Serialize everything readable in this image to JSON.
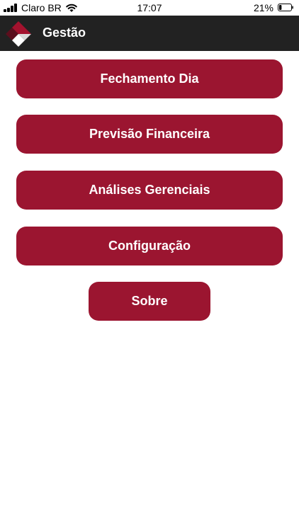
{
  "status_bar": {
    "carrier": "Claro BR",
    "time": "17:07",
    "battery": "21%",
    "signal_icon": "signal-bars-icon",
    "wifi_icon": "wifi-icon",
    "battery_icon": "battery-icon",
    "battery_level": 0.21
  },
  "nav": {
    "title": "Gestão",
    "logo_icon": "app-logo-icon"
  },
  "menu": {
    "items": [
      {
        "label": "Fechamento Dia"
      },
      {
        "label": "Previsão Financeira"
      },
      {
        "label": "Análises Gerenciais"
      },
      {
        "label": "Configuração"
      }
    ],
    "about_label": "Sobre"
  },
  "colors": {
    "accent": "#9b1530",
    "navbar": "#222222",
    "background": "#ffffff",
    "button_text": "#ffffff"
  }
}
